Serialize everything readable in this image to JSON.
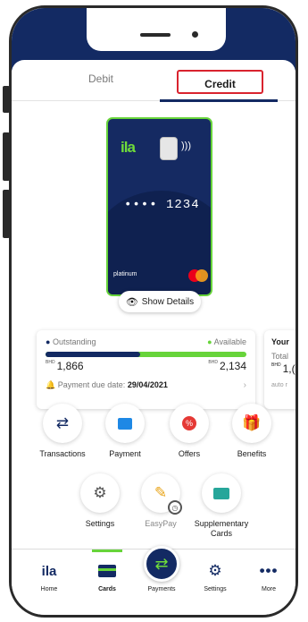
{
  "tabs": {
    "debit": "Debit",
    "credit": "Credit"
  },
  "card": {
    "brand_logo": "ila",
    "masked_number": "•••• 1234",
    "tier": "platinum",
    "show_details": "Show Details"
  },
  "summary": {
    "outstanding_label": "Outstanding",
    "available_label": "Available",
    "currency": "BHD",
    "outstanding_amount": "1,866",
    "available_amount": "2,134",
    "due_label": "Payment due date:",
    "due_date": "29/04/2021",
    "outstanding_fraction": 0.47
  },
  "summary2": {
    "title": "Your",
    "total_label": "Total",
    "currency": "BHD",
    "amount": "1,(",
    "footnote": "auto r"
  },
  "actions": [
    {
      "label": "Transactions"
    },
    {
      "label": "Payment"
    },
    {
      "label": "Offers"
    },
    {
      "label": "Benefits"
    },
    {
      "label": "Settings"
    },
    {
      "label": "EasyPay"
    },
    {
      "label": "Supplementary Cards"
    }
  ],
  "nav": [
    {
      "label": "Home"
    },
    {
      "label": "Cards"
    },
    {
      "label": "Payments"
    },
    {
      "label": "Settings"
    },
    {
      "label": "More"
    }
  ],
  "colors": {
    "navy": "#132a63",
    "green": "#67d43a",
    "red": "#d9232e"
  }
}
